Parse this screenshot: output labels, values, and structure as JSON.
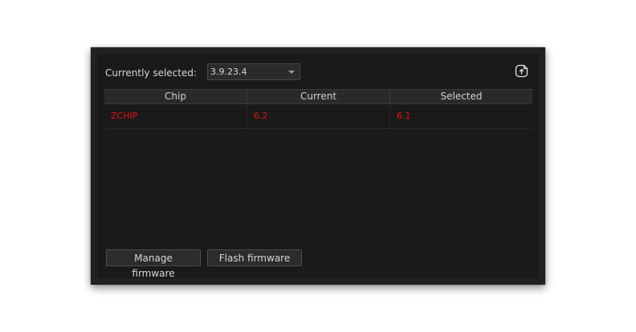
{
  "selection": {
    "label": "Currently selected:",
    "value": "3.9.23.4"
  },
  "icons": {
    "export": "export-file-icon",
    "dropdown": "chevron-down-icon"
  },
  "table": {
    "headers": [
      "Chip",
      "Current",
      "Selected"
    ],
    "rows": [
      {
        "chip": "ZCHIP",
        "current": "6.2",
        "selected": "6.1"
      }
    ],
    "mismatch_color": "#e01010"
  },
  "buttons": {
    "manage": "Manage firmware",
    "flash": "Flash firmware"
  }
}
